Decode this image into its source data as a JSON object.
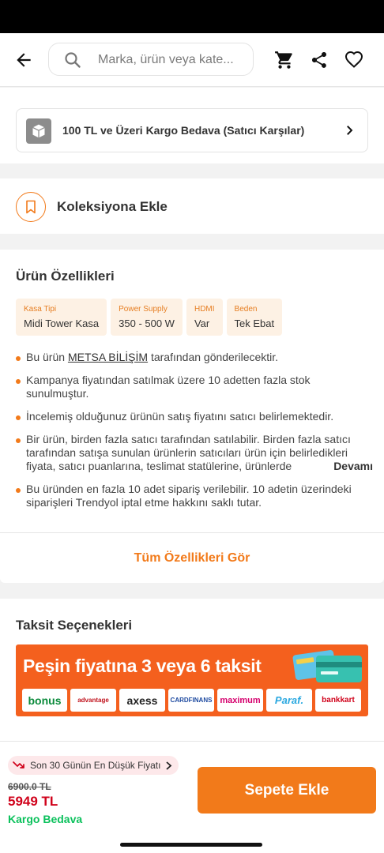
{
  "header": {
    "search_placeholder": "Marka, ürün veya kate..."
  },
  "cargo_banner": {
    "text": "100 TL ve Üzeri Kargo Bedava (Satıcı Karşılar)"
  },
  "collection": {
    "label": "Koleksiyona Ekle"
  },
  "features": {
    "title": "Ürün Özellikleri",
    "chips": [
      {
        "key": "Kasa Tipi",
        "value": "Midi Tower Kasa"
      },
      {
        "key": "Power Supply",
        "value": "350 - 500 W"
      },
      {
        "key": "HDMI",
        "value": "Var"
      },
      {
        "key": "Beden",
        "value": "Tek Ebat"
      }
    ],
    "bullets": {
      "seller_prefix": "Bu ürün",
      "seller_name": "METSA BİLİŞİM",
      "seller_suffix": "tarafından gönderilecektir.",
      "b2": "Kampanya fiyatından satılmak üzere 10 adetten fazla stok sunulmuştur.",
      "b3": "İncelemiş olduğunuz ürünün satış fiyatını satıcı belirlemektedir.",
      "b4": "Bir ürün, birden fazla satıcı tarafından satılabilir. Birden fazla satıcı tarafından satışa sunulan ürünlerin satıcıları ürün için belirledikleri fiyata, satıcı puanlarına, teslimat statülerine, ürünlerde",
      "more": "Devamı",
      "b5": "Bu üründen en fazla 10 adet sipariş verilebilir. 10 adetin üzerindeki siparişleri Trendyol iptal etme hakkını saklı tutar."
    },
    "all_features": "Tüm Özellikleri Gör"
  },
  "installments": {
    "title": "Taksit Seçenekleri",
    "banner_text": "Peşin fiyatına 3 veya 6 taksit",
    "logos": [
      "bonus",
      "advantage",
      "axess",
      "CARDFINANS",
      "maximum",
      "Paraf.",
      "bankkart"
    ]
  },
  "bottom": {
    "lowest_price_label": "Son 30 Günün En Düşük Fiyatı",
    "old_price": "6900.0 TL",
    "new_price": "5949 TL",
    "free_cargo": "Kargo Bedava",
    "add_to_cart": "Sepete Ekle"
  },
  "colors": {
    "accent": "#f27a1a",
    "price_red": "#d0021b",
    "green": "#0bc15c"
  }
}
